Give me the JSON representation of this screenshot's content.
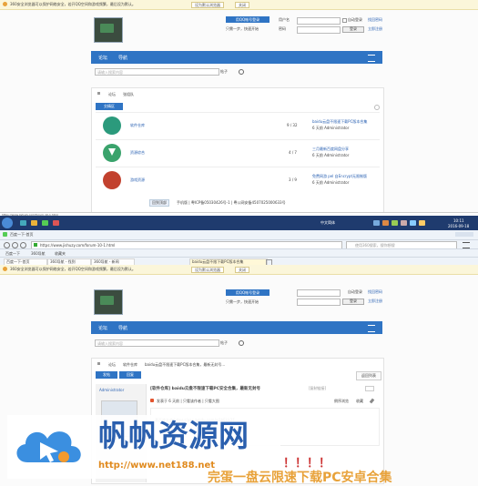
{
  "top": {
    "notice": "360安全浏览器可以保护网络安全，若开QQ空间和游戏频繁，最后设为默认。",
    "set_default": "设为默认浏览器",
    "close": "关闭",
    "user_label": "用户名",
    "pass_label": "密码",
    "auto_login": "自动登录",
    "find_pass": "找回密码",
    "login": "登录",
    "register": "立即注册",
    "qq_login": "用QQ帐号登录",
    "quick_hint": "只需一步，快速开始",
    "nav": [
      "论坛",
      "导航"
    ],
    "search_placeholder": "请输入搜索内容",
    "search_scope": "帖子",
    "breadcrumb": [
      "论坛",
      "张组队"
    ],
    "section_title": "交精区",
    "forums": [
      {
        "name": "软件仓库",
        "count": "9 / 32",
        "last": "baidu云盘不限速下载PC版本合集",
        "by": "6 天前 Administrator"
      },
      {
        "name": "资源综合",
        "count": "4 / 7",
        "last": "三月最新百度网盘分享",
        "by": "6 天前 Administrator"
      },
      {
        "name": "游戏资源",
        "count": "3 / 9",
        "last": "免费网游 pel 自Encrypt无限制版",
        "by": "6 天前 Administrator"
      }
    ],
    "footer": "手机版  |  粤ICP备05030426号-1  |  粤公网安备4507025000633号",
    "footer_btn": "回到顶部"
  },
  "window": {
    "taskbar_time": "10:11",
    "taskbar_date": "2016-09-18",
    "tray_label": "中文简体",
    "address": "https://www.jishuzy.com/forum-10-1.html",
    "address_hint": "使用360搜索，搜你想搜",
    "bookmarks": [
      "百度一下",
      "360导航",
      "收藏夹"
    ],
    "tabs": [
      "百度一下-首页",
      "360导航 - 找到",
      "360导航 - 新闻",
      "baidu云盘不限下载PC版本合集"
    ]
  },
  "bottom": {
    "notice": "360安全浏览器可以保护网络安全，若开QQ空间和游戏频繁，最后设为默认。",
    "set_default": "设为默认浏览器",
    "close": "关闭",
    "nav": [
      "论坛",
      "导航"
    ],
    "breadcrumb": [
      "论坛",
      "软件仓库",
      "baidu云盘不限速下载PC版本合集，最新无封号..."
    ],
    "post_btn": "发帖",
    "reply_btn": "回复",
    "back": "返回列表",
    "author": "Administrator",
    "thread_title": "[软件仓库] baidu云盘不限速下载PC安全合集，最新无封号",
    "thread_meta": "[复制链接]",
    "post_info": "发表于 6 天前  |  只看该作者  |  只看大图",
    "post_sub": "倒序浏览",
    "reply_to": "收藏",
    "body_line": "基百度大会 https://pan.baidu.com/s/1bEUc2F",
    "exclaim": "！！！！"
  },
  "watermark": {
    "brand": "帆帆资源网",
    "url": "http://www.net188.net",
    "bottom_text": "完蛋一盘云限速下载PC安卓合集"
  },
  "colors": {
    "nav": "#2f74c4",
    "notice_bg": "#fbf6da",
    "brand": "#2a5fae",
    "taskbar": "#1f3b6e"
  }
}
